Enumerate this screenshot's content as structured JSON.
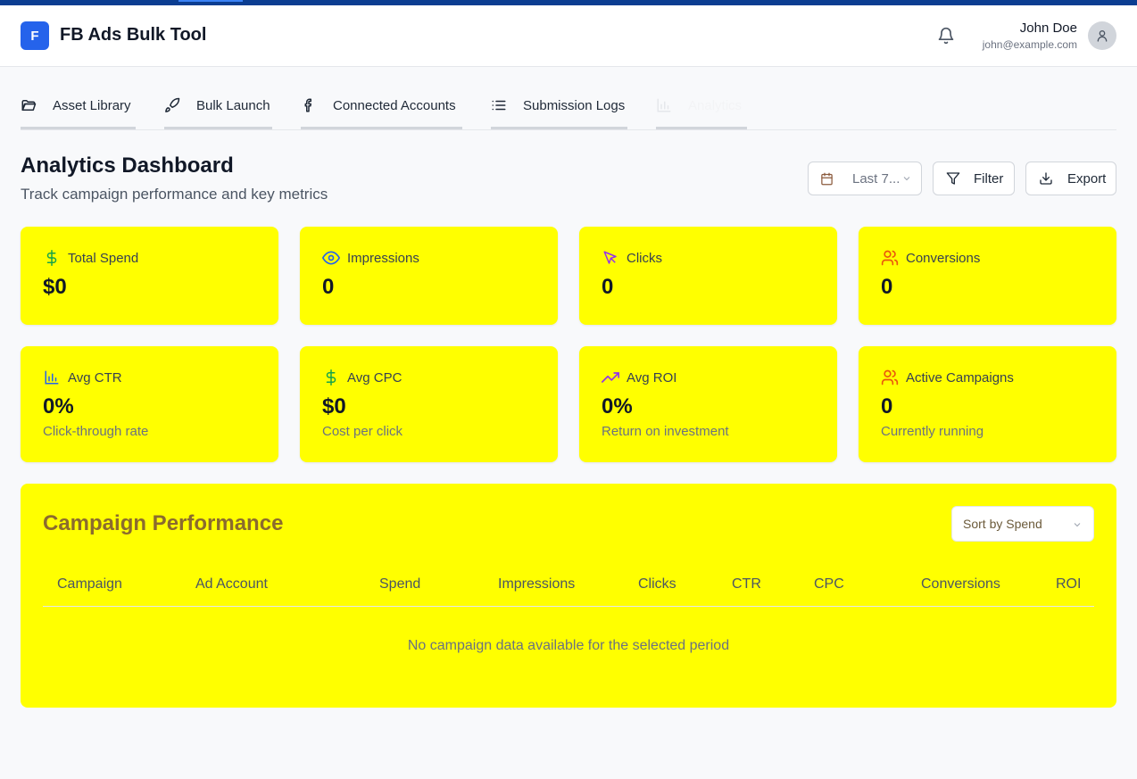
{
  "app": {
    "logo_letter": "F",
    "title": "FB Ads Bulk Tool"
  },
  "user": {
    "name": "John Doe",
    "email": "john@example.com"
  },
  "icons": {
    "notifications": "bell-icon",
    "avatar": "user-icon"
  },
  "tabs": [
    {
      "label": "Asset Library",
      "icon": "folder-icon"
    },
    {
      "label": "Bulk Launch",
      "icon": "rocket-icon"
    },
    {
      "label": "Connected Accounts",
      "icon": "facebook-icon"
    },
    {
      "label": "Submission Logs",
      "icon": "list-icon"
    },
    {
      "label": "Analytics",
      "icon": "bar-chart-icon",
      "active": true
    }
  ],
  "page": {
    "title": "Analytics Dashboard",
    "subtitle": "Track campaign performance and key metrics"
  },
  "toolbar": {
    "date_range": "Last 7...",
    "filter": "Filter",
    "export": "Export"
  },
  "metrics_row1": [
    {
      "label": "Total Spend",
      "value": "$0",
      "icon": "dollar-icon",
      "color": "#16a34a"
    },
    {
      "label": "Impressions",
      "value": "0",
      "icon": "eye-icon",
      "color": "#2563eb"
    },
    {
      "label": "Clicks",
      "value": "0",
      "icon": "cursor-icon",
      "color": "#9333ea"
    },
    {
      "label": "Conversions",
      "value": "0",
      "icon": "users-icon",
      "color": "#ea580c"
    }
  ],
  "metrics_row2": [
    {
      "label": "Avg CTR",
      "value": "0%",
      "desc": "Click-through rate",
      "icon": "bar-chart-icon",
      "color": "#2563eb"
    },
    {
      "label": "Avg CPC",
      "value": "$0",
      "desc": "Cost per click",
      "icon": "dollar-icon",
      "color": "#16a34a"
    },
    {
      "label": "Avg ROI",
      "value": "0%",
      "desc": "Return on investment",
      "icon": "trending-up-icon",
      "color": "#9333ea"
    },
    {
      "label": "Active Campaigns",
      "value": "0",
      "desc": "Currently running",
      "icon": "users-icon",
      "color": "#ea580c"
    }
  ],
  "performance": {
    "title": "Campaign Performance",
    "sort_label": "Sort by Spend",
    "columns": [
      "Campaign",
      "Ad Account",
      "Spend",
      "Impressions",
      "Clicks",
      "CTR",
      "CPC",
      "Conversions",
      "ROI"
    ],
    "empty_message": "No campaign data available for the selected period"
  }
}
